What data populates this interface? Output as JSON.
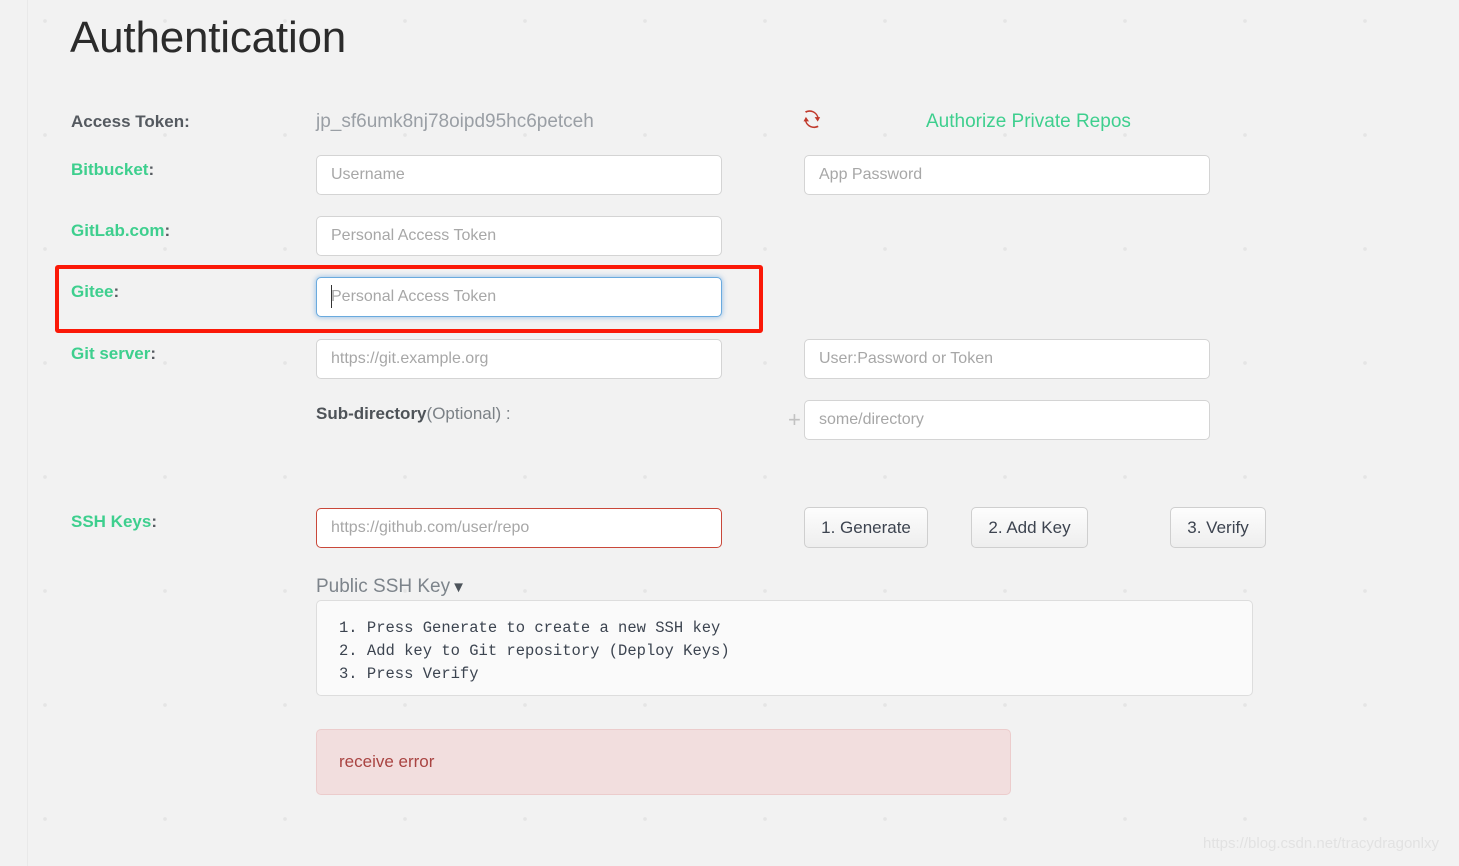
{
  "page": {
    "title": "Authentication",
    "watermark": "https://blog.csdn.net/tracydragonlxy"
  },
  "colors": {
    "accent_green": "#3ecf8e",
    "annotation_red": "#fb1908",
    "error_text": "#a94442",
    "error_bg": "#f2dede",
    "refresh_icon": "#c0392b",
    "focus_blue": "#6aaade",
    "page_bg": "#f2f2f2"
  },
  "access_token": {
    "label": "Access Token:",
    "value": "jp_sf6umk8nj78oipd95hc6petceh"
  },
  "authorize": {
    "icon": "refresh-icon",
    "link_label": "Authorize Private Repos"
  },
  "rows": {
    "bitbucket": {
      "label": "Bitbucket",
      "colon": ":",
      "username_placeholder": "Username",
      "username_value": "",
      "app_password_placeholder": "App Password",
      "app_password_value": ""
    },
    "gitlab": {
      "label": "GitLab.com",
      "colon": ":",
      "token_placeholder": "Personal Access Token",
      "token_value": ""
    },
    "gitee": {
      "label": "Gitee",
      "colon": ":",
      "token_placeholder": "Personal Access Token",
      "token_value": "",
      "focused": true,
      "highlighted": true
    },
    "git_server": {
      "label": "Git server",
      "colon": ":",
      "url_placeholder": "https://git.example.org",
      "url_value": "",
      "credentials_placeholder": "User:Password or Token",
      "credentials_value": ""
    },
    "sub_directory": {
      "label_strong": "Sub-directory",
      "label_light": "(Optional) :",
      "plus": "+",
      "placeholder": "some/directory",
      "value": ""
    },
    "ssh_keys": {
      "label": "SSH Keys",
      "colon": ":",
      "repo_placeholder": "https://github.com/user/repo",
      "repo_value": "",
      "repo_has_error": true,
      "buttons": [
        {
          "label": "1. Generate",
          "name": "generate-button"
        },
        {
          "label": "2. Add Key",
          "name": "add-key-button"
        },
        {
          "label": "3. Verify",
          "name": "verify-button"
        }
      ],
      "public_key_toggle": "Public SSH Key",
      "chevron": "♥",
      "instructions": "1. Press Generate to create a new SSH key\n2. Add key to Git repository (Deploy Keys)\n3. Press Verify"
    }
  },
  "error": {
    "message": "receive error"
  }
}
